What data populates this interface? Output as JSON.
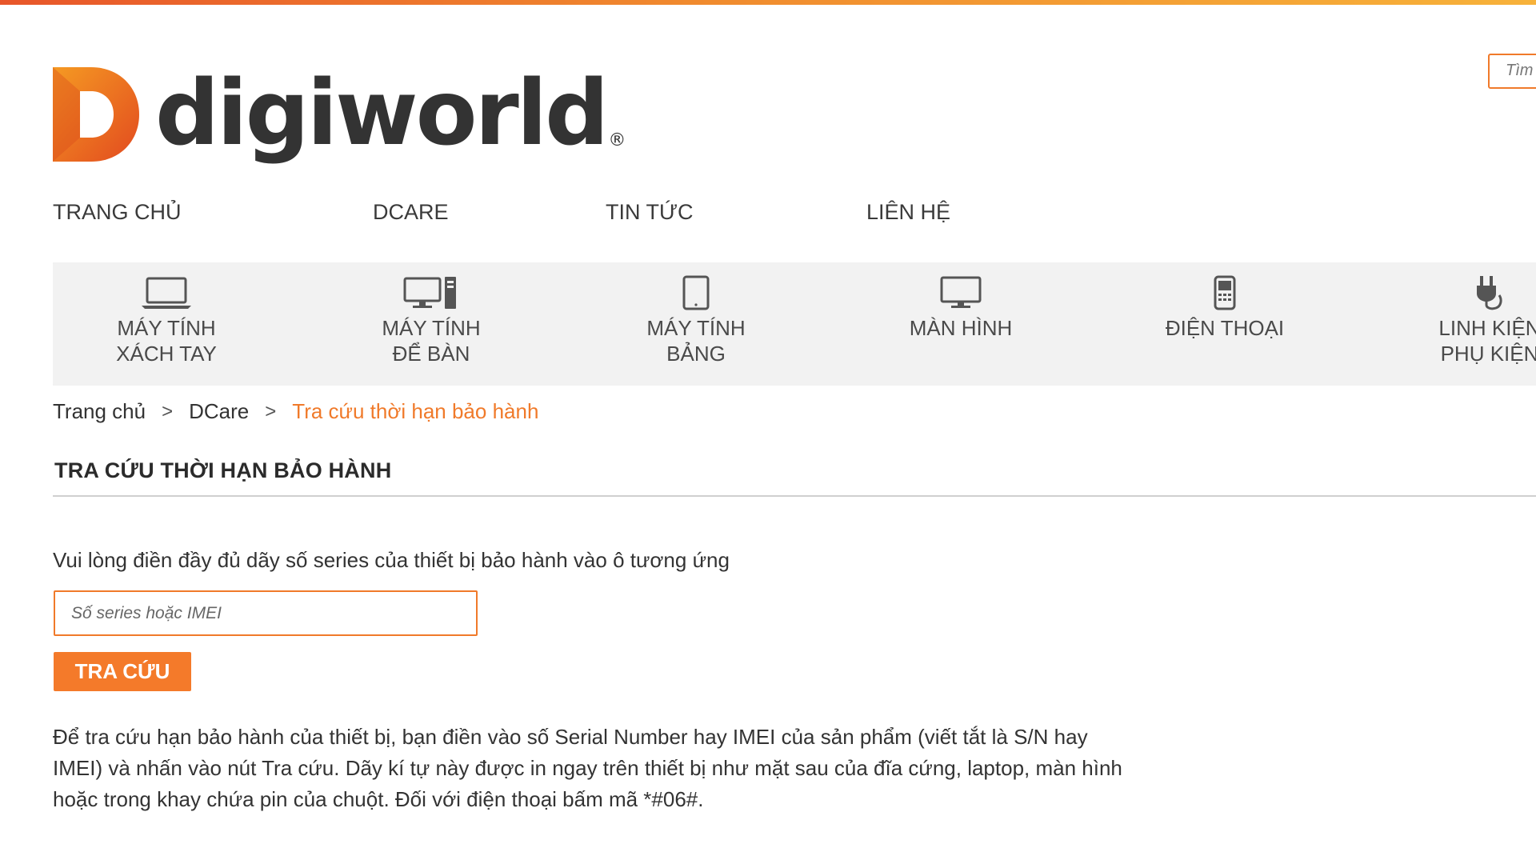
{
  "brand": {
    "name": "digiworld",
    "registered_mark": "®",
    "accent_color": "#f07a2a"
  },
  "header": {
    "search_placeholder": "Tìm"
  },
  "main_nav": [
    {
      "label": "TRANG CHỦ"
    },
    {
      "label": "DCARE"
    },
    {
      "label": "TIN TỨC"
    },
    {
      "label": "LIÊN HỆ"
    }
  ],
  "categories": [
    {
      "label": "MÁY TÍNH\nXÁCH TAY",
      "icon": "laptop-icon"
    },
    {
      "label": "MÁY TÍNH\nĐỂ BÀN",
      "icon": "desktop-icon"
    },
    {
      "label": "MÁY TÍNH\nBẢNG",
      "icon": "tablet-icon"
    },
    {
      "label": "MÀN HÌNH",
      "icon": "monitor-icon"
    },
    {
      "label": "ĐIỆN THOẠI",
      "icon": "phone-icon"
    },
    {
      "label": "LINH KIỆN\nPHỤ KIỆN",
      "icon": "plug-icon"
    }
  ],
  "breadcrumb": {
    "items": [
      "Trang chủ",
      "DCare"
    ],
    "separator": ">",
    "current": "Tra cứu thời hạn bảo hành"
  },
  "page": {
    "title": "TRA CỨU THỜI HẠN BẢO HÀNH",
    "instruction": "Vui lòng điền đầy đủ dãy số series của thiết bị bảo hành vào ô tương ứng",
    "input_value": "",
    "input_placeholder": "Số series hoặc IMEI",
    "submit_label": "TRA CỨU",
    "help_text": "Để tra cứu hạn bảo hành của thiết bị, bạn điền vào số Serial Number hay IMEI của sản phẩm (viết tắt là S/N hay IMEI) và nhấn vào nút Tra cứu. Dãy kí tự này được in ngay trên thiết bị như mặt sau của đĩa cứng, laptop, màn hình hoặc trong khay chứa pin của chuột. Đối với điện thoại bấm mã *#06#."
  }
}
